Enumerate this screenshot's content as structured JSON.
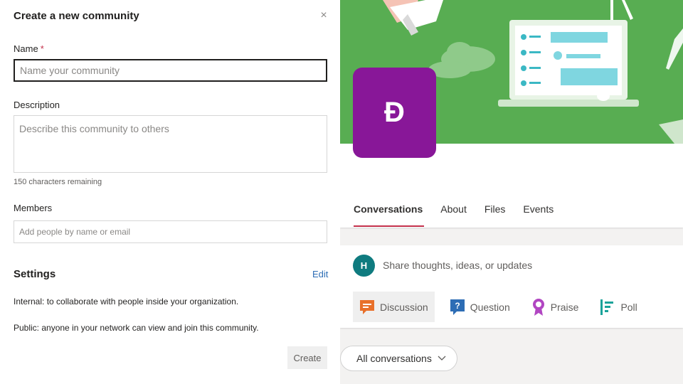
{
  "dialog": {
    "title": "Create a new community",
    "close_glyph": "×",
    "name_label": "Name",
    "required_mark": "*",
    "name_placeholder": "Name your community",
    "description_label": "Description",
    "description_placeholder": "Describe this community to others",
    "chars_remaining": "150 characters remaining",
    "members_label": "Members",
    "members_placeholder": "Add people by name or email",
    "settings_title": "Settings",
    "edit_label": "Edit",
    "internal_text": "Internal: to collaborate with people inside your organization.",
    "public_text": "Public: anyone in your network can view and join this community.",
    "create_label": "Create"
  },
  "preview": {
    "avatar_letter": "Đ",
    "avatar_color": "#881798",
    "banner_color": "#58ad52",
    "tabs": [
      {
        "label": "Conversations",
        "active": true
      },
      {
        "label": "About",
        "active": false
      },
      {
        "label": "Files",
        "active": false
      },
      {
        "label": "Events",
        "active": false
      }
    ],
    "user_initial": "H",
    "share_placeholder": "Share thoughts, ideas, or updates",
    "post_types": [
      {
        "label": "Discussion",
        "icon": "discussion-icon",
        "color": "#e8702a"
      },
      {
        "label": "Question",
        "icon": "question-icon",
        "color": "#2d6db5"
      },
      {
        "label": "Praise",
        "icon": "praise-icon",
        "color": "#b146c2"
      },
      {
        "label": "Poll",
        "icon": "poll-icon",
        "color": "#1aa39a"
      }
    ],
    "filter_label": "All conversations"
  }
}
